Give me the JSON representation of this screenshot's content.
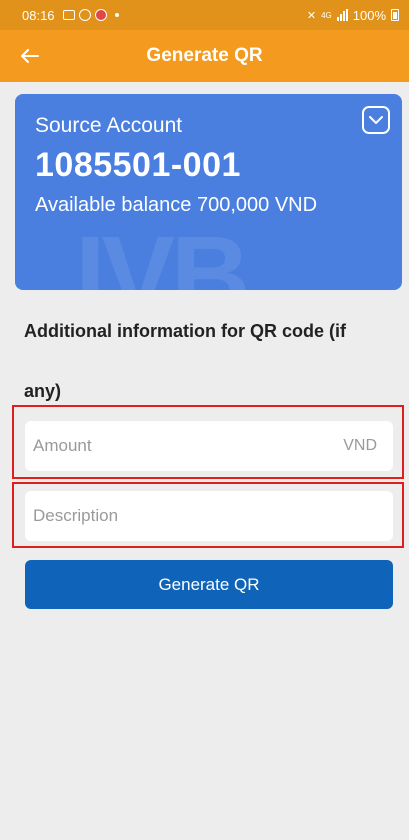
{
  "status_bar": {
    "time": "08:16",
    "battery": "100%",
    "network_small": "4G"
  },
  "header": {
    "title": "Generate QR"
  },
  "account_card": {
    "label": "Source Account",
    "number": "1085501-001",
    "balance": "Available balance 700,000 VND",
    "watermark": "IVB",
    "color": "#4a7fe0"
  },
  "form": {
    "section_title_line1": "Additional information for QR code (if",
    "section_title_line2": "any)",
    "amount_placeholder": "Amount",
    "amount_unit": "VND",
    "description_placeholder": "Description"
  },
  "actions": {
    "generate_label": "Generate QR"
  },
  "colors": {
    "header": "#f39a1f",
    "status_bar": "#e0921a",
    "button": "#0f63b8",
    "highlight": "#e01e1e"
  }
}
